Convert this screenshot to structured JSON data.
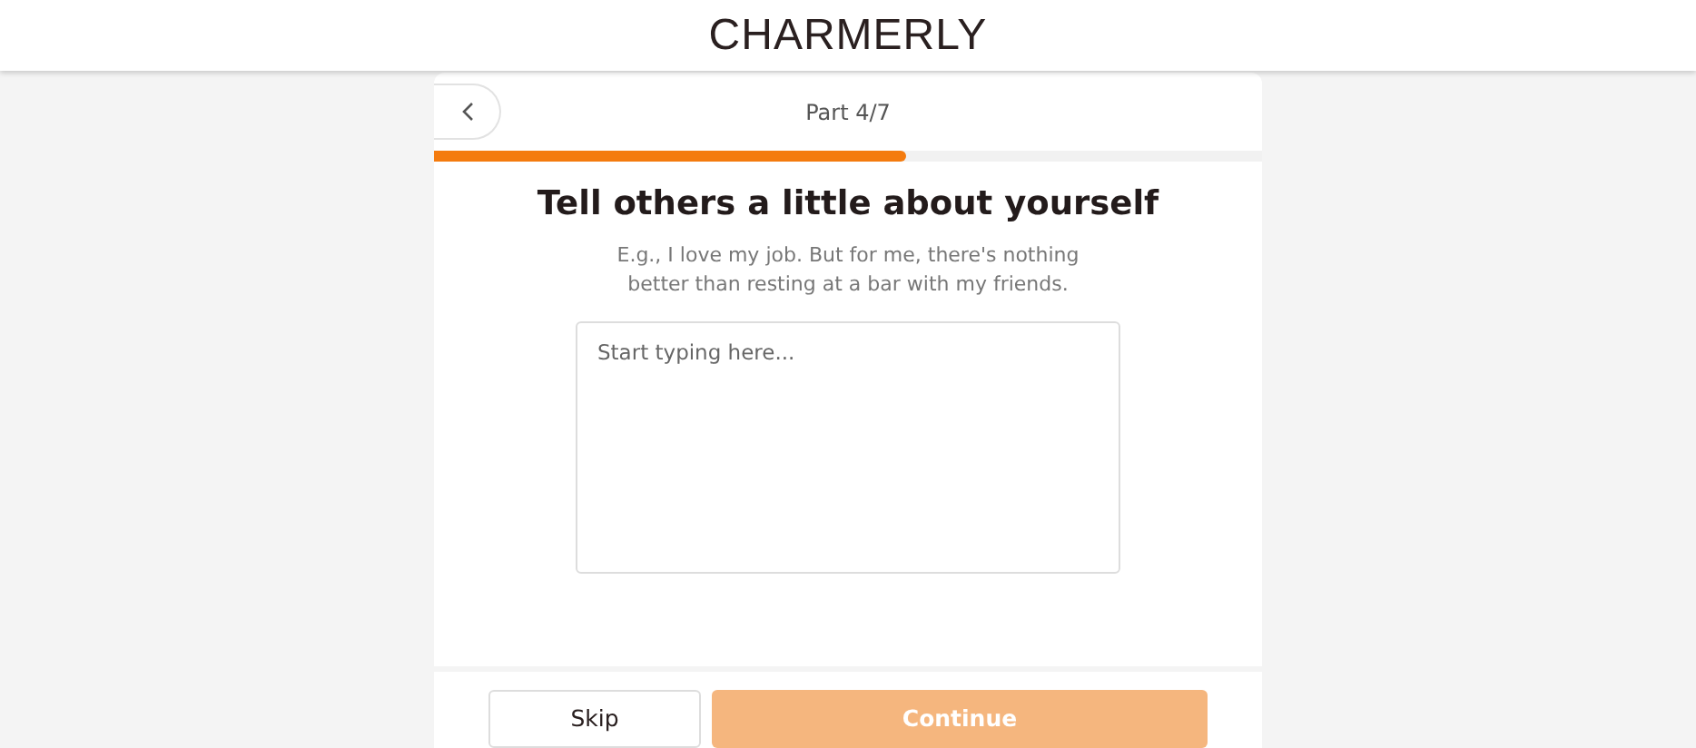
{
  "header": {
    "logo": "CHARMERLY"
  },
  "step": {
    "label": "Part 4/7",
    "level": 0.571
  },
  "question": {
    "title": "Tell others a little about yourself",
    "hint": "E.g., I love my job. But for me, there's nothing better than resting at a bar with my friends.",
    "placeholder": "Start typing here..."
  },
  "buttons": [
    {
      "kind": "secondary",
      "label": "Skip",
      "disabled": false
    },
    {
      "kind": "primary",
      "label": "Continue",
      "disabled": true
    }
  ]
}
